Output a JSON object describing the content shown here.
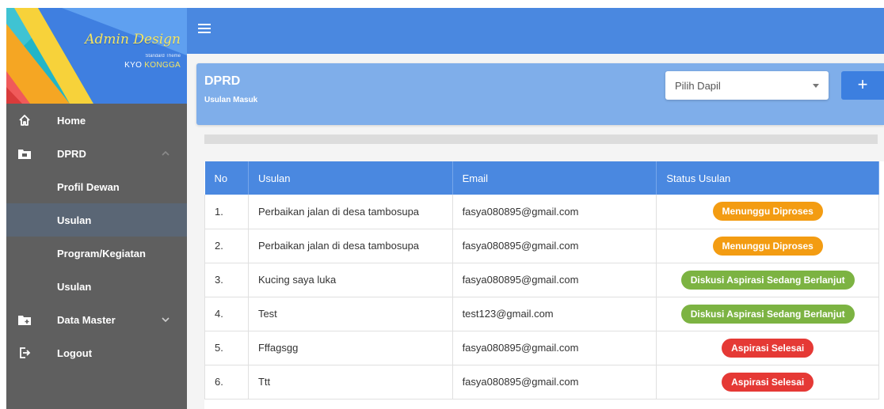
{
  "brand": {
    "title": "Admin Design",
    "subtitle": "Standard Theme",
    "author_first": "KYO",
    "author_second": "KONGGA"
  },
  "sidebar": {
    "items": [
      {
        "label": "Home",
        "icon": "home-icon"
      },
      {
        "label": "DPRD",
        "icon": "folder-icon",
        "expanded": true
      },
      {
        "label": "Profil Dewan"
      },
      {
        "label": "Usulan",
        "active": true
      },
      {
        "label": "Program/Kegiatan"
      },
      {
        "label": "Usulan"
      },
      {
        "label": "Data Master",
        "icon": "folder-add-icon",
        "expanded": false
      },
      {
        "label": "Logout",
        "icon": "logout-icon"
      }
    ]
  },
  "header": {
    "title": "DPRD",
    "subtitle": "Usulan Masuk",
    "dapil_select": {
      "selected": "Pilih Dapil"
    },
    "add_label": "+"
  },
  "table": {
    "columns": [
      "No",
      "Usulan",
      "Email",
      "Status Usulan"
    ],
    "rows": [
      {
        "no": "1.",
        "usulan": "Perbaikan jalan di desa tambosupa",
        "email": "fasya080895@gmail.com",
        "status": "Menunggu Diproses",
        "status_color": "#f39c12"
      },
      {
        "no": "2.",
        "usulan": "Perbaikan jalan di desa tambosupa",
        "email": "fasya080895@gmail.com",
        "status": "Menunggu Diproses",
        "status_color": "#f39c12"
      },
      {
        "no": "3.",
        "usulan": "Kucing saya luka",
        "email": "fasya080895@gmail.com",
        "status": "Diskusi Aspirasi Sedang Berlanjut",
        "status_color": "#7cb342"
      },
      {
        "no": "4.",
        "usulan": "Test",
        "email": "test123@gmail.com",
        "status": "Diskusi Aspirasi Sedang Berlanjut",
        "status_color": "#7cb342"
      },
      {
        "no": "5.",
        "usulan": "Fffagsgg",
        "email": "fasya080895@gmail.com",
        "status": "Aspirasi Selesai",
        "status_color": "#e53935"
      },
      {
        "no": "6.",
        "usulan": "Ttt",
        "email": "fasya080895@gmail.com",
        "status": "Aspirasi Selesai",
        "status_color": "#e53935"
      }
    ]
  },
  "colors": {
    "primary": "#4a88e0",
    "sidebar": "#5f5f5f",
    "header_card": "#7faeea"
  }
}
